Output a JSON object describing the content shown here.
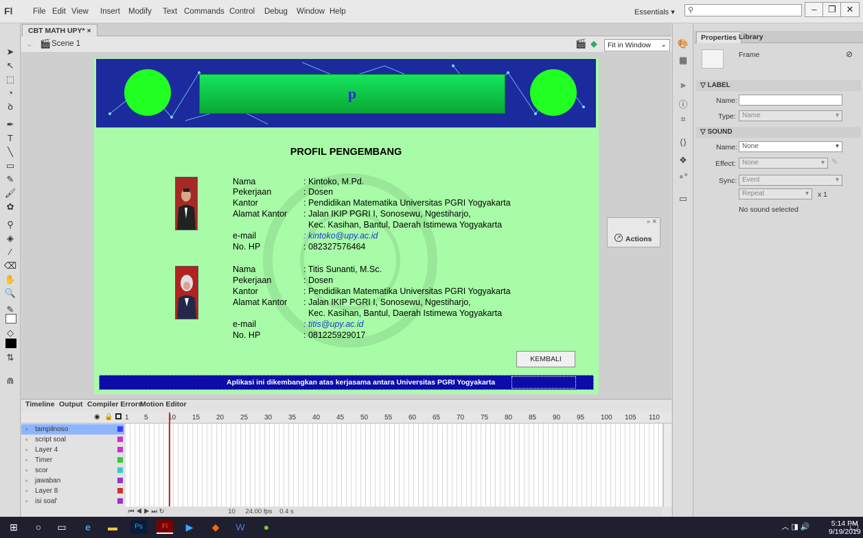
{
  "app": {
    "logo": "Fl",
    "menu": [
      "File",
      "Edit",
      "View",
      "Insert",
      "Modify",
      "Text",
      "Commands",
      "Control",
      "Debug",
      "Window",
      "Help"
    ],
    "workspace": "Essentials ▾",
    "search_icon": "⚲"
  },
  "document": {
    "tab": "CBT MATH UPY*",
    "tab_close": "×",
    "scene": "Scene 1",
    "zoom": "Fit in Window"
  },
  "stage": {
    "banner_letter": "p",
    "title": "PROFIL PENGEMBANG",
    "developers": [
      {
        "labels": [
          "Nama",
          "Pekerjaan",
          "Kantor",
          "Alamat Kantor",
          "",
          "e-mail",
          "No. HP"
        ],
        "values": [
          ": Kintoko, M.Pd.",
          ": Dosen",
          ": Pendidikan Matematika Universitas PGRI Yogyakarta",
          ": Jalan IKIP PGRI I, Sonosewu, Ngestiharjo,",
          "  Kec. Kasihan, Bantul, Daerah Istimewa Yogyakarta",
          ": kintoko@upy.ac.id",
          ": 082327576464"
        ]
      },
      {
        "labels": [
          "Nama",
          "Pekerjaan",
          "Kantor",
          "Alamat Kantor",
          "",
          "e-mail",
          "No. HP"
        ],
        "values": [
          ": Titis Sunanti, M.Sc.",
          ": Dosen",
          ": Pendidikan Matematika Universitas PGRI Yogyakarta",
          ": Jalan IKIP PGRI I, Sonosewu, Ngestiharjo,",
          "  Kec. Kasihan, Bantul, Daerah Istimewa Yogyakarta",
          ": titis@upy.ac.id",
          ": 081225929017"
        ]
      }
    ],
    "back_button": "KEMBALI",
    "footer": "Aplikasi ini dikembangkan atas kerjasama antara Universitas PGRI Yogyakarta"
  },
  "actions_panel": {
    "label": "Actions"
  },
  "properties": {
    "tabs": [
      "Properties",
      "Library"
    ],
    "frame_label": "Frame",
    "label_section": "LABEL",
    "name_label": "Name:",
    "type_label": "Type:",
    "type_value": "Name",
    "sound_section": "SOUND",
    "sound_name_label": "Name:",
    "sound_name_value": "None",
    "effect_label": "Effect:",
    "effect_value": "None",
    "sync_label": "Sync:",
    "sync_value": "Event",
    "repeat_value": "Repeat",
    "repeat_count": "x 1",
    "no_sound": "No sound selected"
  },
  "timeline": {
    "tabs": [
      "Timeline",
      "Output",
      "Compiler Errors",
      "Motion Editor"
    ],
    "frame_numbers": [
      "1",
      "5",
      "10",
      "15",
      "20",
      "25",
      "30",
      "35",
      "40",
      "45",
      "50",
      "55",
      "60",
      "65",
      "70",
      "75",
      "80",
      "85",
      "90",
      "95",
      "100",
      "105",
      "110"
    ],
    "layers": [
      "tampilnoso",
      "script soal",
      "Layer 4",
      "Timer",
      "scor",
      "jawaban",
      "Layer 8",
      "isi soal'"
    ],
    "layer_colors": [
      "#3c3cff",
      "#cc33cc",
      "#cc33cc",
      "#33cc33",
      "#33cccc",
      "#9933cc",
      "#cc3333",
      "#9933cc"
    ],
    "status": {
      "frame": "10",
      "fps": "24.00 fps",
      "time": "0.4 s"
    }
  },
  "taskbar": {
    "time": "5:14 PM",
    "date": "9/19/2019"
  }
}
